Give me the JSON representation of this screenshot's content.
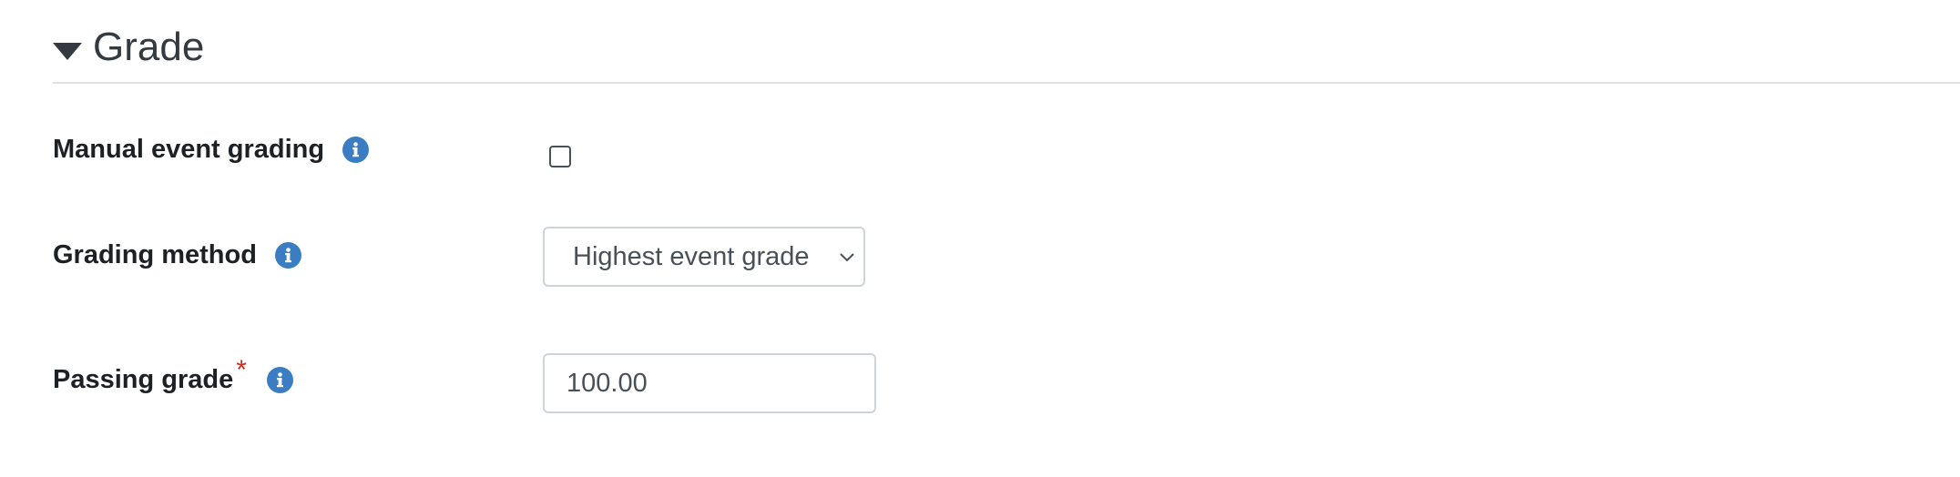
{
  "section": {
    "title": "Grade",
    "expanded": true
  },
  "fields": {
    "manual_event_grading": {
      "label": "Manual event grading",
      "checked": false
    },
    "grading_method": {
      "label": "Grading method",
      "selected": "Highest event grade"
    },
    "passing_grade": {
      "label": "Passing grade",
      "required_marker": "*",
      "value": "100.00"
    }
  },
  "icons": {
    "section_toggle": "caret-down-icon",
    "help": "info-icon",
    "select_arrow": "chevron-down-icon"
  },
  "colors": {
    "info_icon": "#3b7dc3",
    "required": "#ca3120",
    "heading": "#343a40",
    "label": "#1d2125",
    "input_border": "#ced4da",
    "input_text": "#495057"
  }
}
